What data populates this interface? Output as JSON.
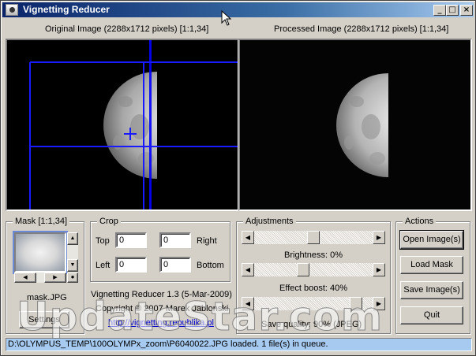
{
  "window": {
    "title": "Vignetting Reducer"
  },
  "images": {
    "original_caption": "Original Image (2288x1712 pixels) [1:1,34]",
    "processed_caption": "Processed Image (2288x1712 pixels) [1:1,34]"
  },
  "mask": {
    "group_label": "Mask [1:1,34]",
    "filename": "mask.JPG",
    "settings_label": "Settings"
  },
  "crop": {
    "group_label": "Crop",
    "top_label": "Top",
    "top_value": "0",
    "right_label": "Right",
    "right_value": "0",
    "left_label": "Left",
    "left_value": "0",
    "bottom_label": "Bottom",
    "bottom_value": "0"
  },
  "about": {
    "version": "Vignetting Reducer 1.3 (5-Mar-2009)",
    "copyright": "Copyright © 2007 Marek Jablonski",
    "url": "http://vignetting.republika.pl"
  },
  "adjustments": {
    "group_label": "Adjustments",
    "brightness_label": "Brightness: 0%",
    "brightness_fraction": 0.5,
    "effect_boost_label": "Effect boost: 40%",
    "effect_boost_fraction": 0.4,
    "save_quality_label": "Save quality: 90% (JPEG)",
    "save_quality_fraction": 0.9
  },
  "actions": {
    "group_label": "Actions",
    "open_label": "Open Image(s)",
    "load_mask_label": "Load Mask",
    "save_label": "Save Image(s)",
    "quit_label": "Quit"
  },
  "status": "D:\\OLYMPUS_TEMP\\100OLYMPx_zoom\\P6040022.JPG loaded. 1 file(s) in queue.",
  "watermark": "UpdateStar.com",
  "icons": [
    "app-icon",
    "minimize-icon",
    "maximize-icon",
    "close-icon",
    "arrow-cursor-icon",
    "scroll-up-icon",
    "scroll-down-icon",
    "scroll-left-icon",
    "scroll-right-icon",
    "slider-left-icon",
    "slider-right-icon"
  ]
}
